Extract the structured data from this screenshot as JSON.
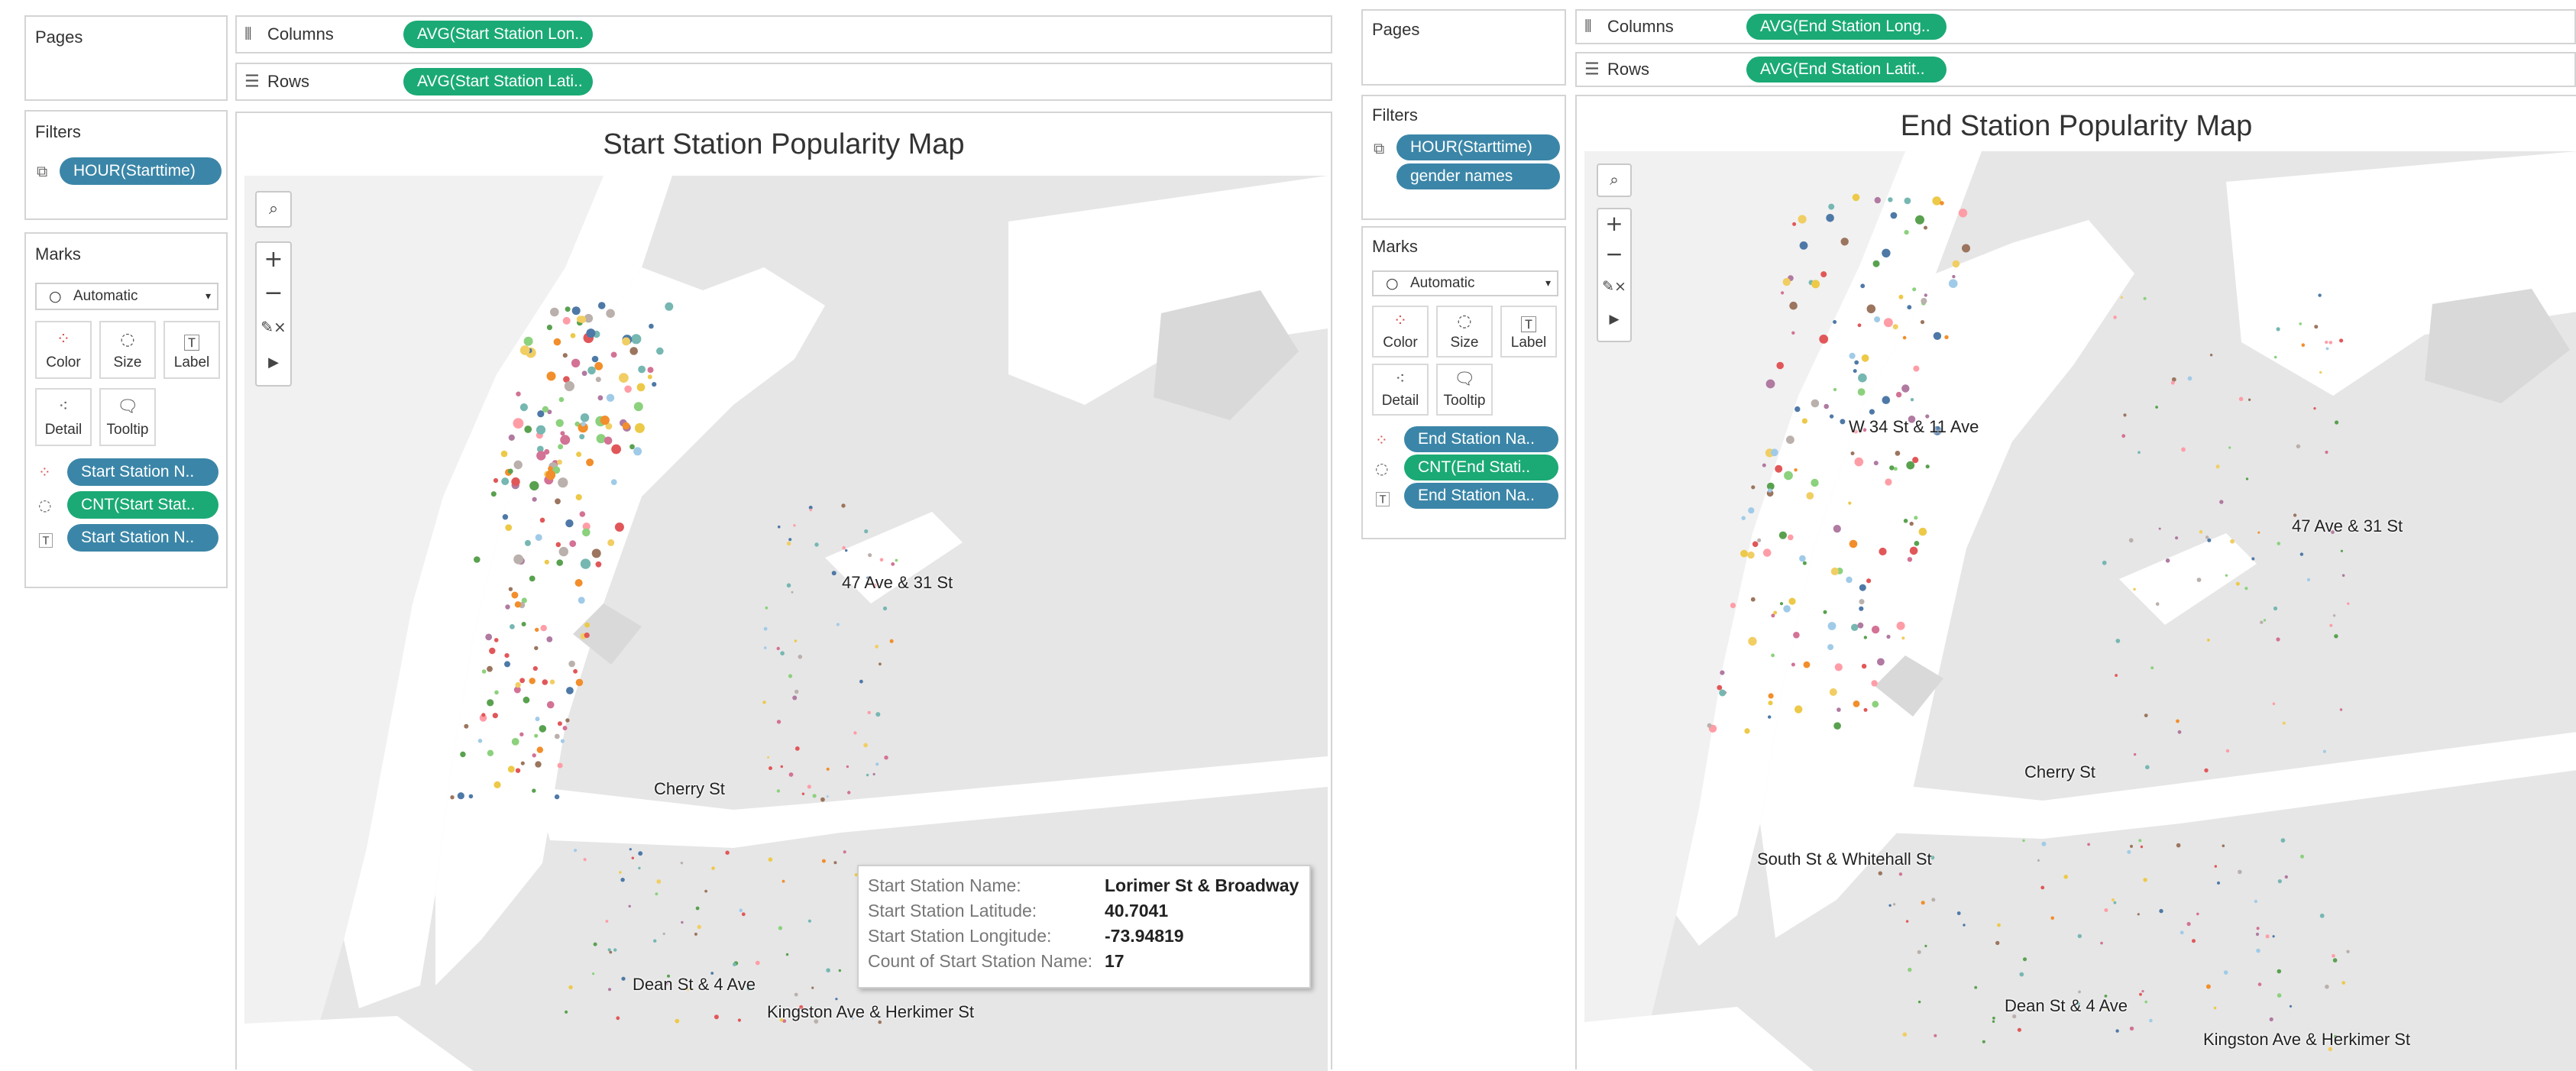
{
  "left": {
    "pages": {
      "label": "Pages"
    },
    "columns": {
      "label": "Columns",
      "pill": "AVG(Start Station Lon.."
    },
    "rows": {
      "label": "Rows",
      "pill": "AVG(Start Station Lati.."
    },
    "filters": {
      "label": "Filters",
      "pills": [
        "HOUR(Starttime)"
      ]
    },
    "marks": {
      "label": "Marks",
      "type": "Automatic",
      "buttons": [
        "Color",
        "Size",
        "Label",
        "Detail",
        "Tooltip"
      ],
      "fields": [
        "Start Station N..",
        "CNT(Start Stat..",
        "Start Station N.."
      ]
    },
    "map": {
      "title": "Start Station Popularity Map",
      "labels": [
        "47 Ave & 31 St",
        "Cherry St",
        "Dean St & 4 Ave",
        "Kingston Ave & Herkimer St"
      ],
      "controls": {
        "plus": "+",
        "minus": "−"
      }
    },
    "tooltip": {
      "rows": [
        {
          "key": "Start Station Name:",
          "value": "Lorimer St & Broadway"
        },
        {
          "key": "Start Station Latitude:",
          "value": "40.7041"
        },
        {
          "key": "Start Station Longitude:",
          "value": "-73.94819"
        },
        {
          "key": "Count of Start Station Name:",
          "value": "17"
        }
      ]
    }
  },
  "right": {
    "pages": {
      "label": "Pages"
    },
    "columns": {
      "label": "Columns",
      "pill": "AVG(End Station Long.."
    },
    "rows": {
      "label": "Rows",
      "pill": "AVG(End Station Latit.."
    },
    "filters": {
      "label": "Filters",
      "pills": [
        "HOUR(Starttime)",
        "gender names"
      ]
    },
    "marks": {
      "label": "Marks",
      "type": "Automatic",
      "buttons": [
        "Color",
        "Size",
        "Label",
        "Detail",
        "Tooltip"
      ],
      "fields": [
        "End Station Na..",
        "CNT(End Stati..",
        "End Station Na.."
      ]
    },
    "map": {
      "title": "End Station Popularity Map",
      "labels": [
        "W 34 St & 11 Ave",
        "47 Ave & 31 St",
        "Cherry St",
        "South St & Whitehall St",
        "Dean St & 4 Ave",
        "Kingston Ave & Herkimer St"
      ],
      "controls": {
        "plus": "+",
        "minus": "−"
      }
    }
  },
  "colors": {
    "pill_green": "#1baa75",
    "pill_blue": "#3b86a8",
    "land": "#e6e6e6",
    "water": "#ffffff"
  },
  "icons": [
    "columns-icon",
    "rows-icon",
    "filter-icon",
    "color-icon",
    "size-icon",
    "label-icon",
    "detail-icon",
    "tooltip-icon",
    "search-icon",
    "pin-clear-icon",
    "play-icon",
    "dropdown-icon"
  ]
}
